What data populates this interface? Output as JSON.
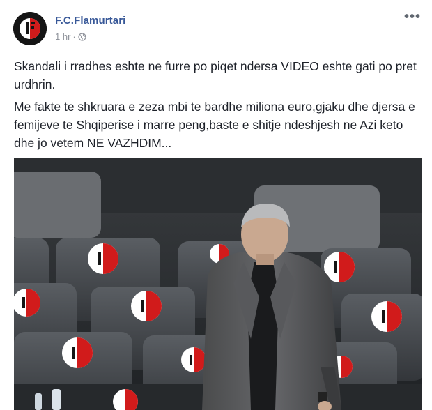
{
  "post": {
    "page_name": "F.C.Flamurtari",
    "timestamp": "1 hr",
    "separator": "·",
    "privacy_icon": "globe-icon",
    "more_icon": "more-options-icon",
    "paragraphs": [
      "Skandali i rradhes eshte ne furre po piqet ndersa VIDEO eshte gati po pret urdhrin.",
      "Me fakte te shkruara e zeza mbi te bardhe miliona euro,gjaku dhe djersa e femijeve te Shqiperise i marre peng,baste e shitje ndeshjesh ne Azi keto dhe jo vetem NE VAZHDIM..."
    ],
    "photo": {
      "subject": "man in grey suit standing among stadium seats with club logos"
    }
  },
  "colors": {
    "link": "#385898",
    "text": "#1d2129",
    "meta": "#90949c",
    "club_red": "#d11b1b"
  }
}
